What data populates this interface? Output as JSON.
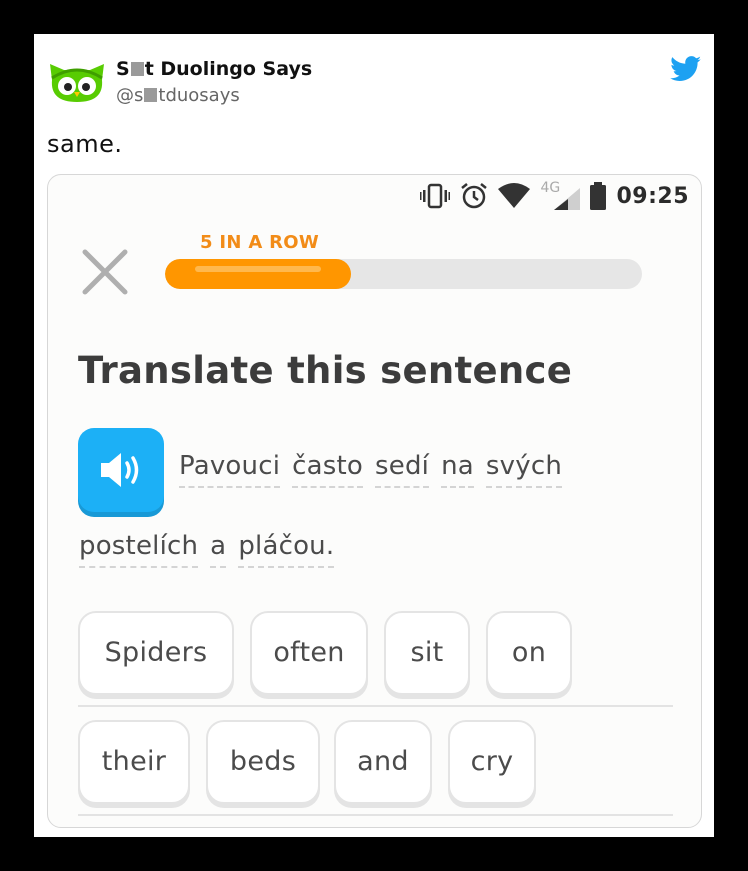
{
  "tweet": {
    "author_name_part1": "S",
    "author_name_part2": "t Duolingo Says",
    "author_handle_part1": "@s",
    "author_handle_part2": "tduosays",
    "text": "same."
  },
  "colors": {
    "twitter_blue": "#1da1f2",
    "duo_green": "#58cc02",
    "streak_orange": "#ff9600",
    "speaker_blue": "#1cb0f6"
  },
  "screenshot": {
    "status_bar": {
      "icons": [
        "vibrate-icon",
        "alarm-icon",
        "wifi-icon",
        "signal-icon",
        "battery-icon"
      ],
      "network": "4G",
      "time": "09:25"
    },
    "streak_label": "5 IN A ROW",
    "progress_fraction": 0.39,
    "prompt_title": "Translate this sentence",
    "source_sentence": {
      "line1": [
        "Pavouci",
        "často",
        "sedí",
        "na",
        "svých"
      ],
      "line2": [
        "postelích",
        "a",
        "pláčou."
      ]
    },
    "answer_chips": {
      "row1": [
        "Spiders",
        "often",
        "sit",
        "on"
      ],
      "row2": [
        "their",
        "beds",
        "and",
        "cry"
      ]
    }
  }
}
